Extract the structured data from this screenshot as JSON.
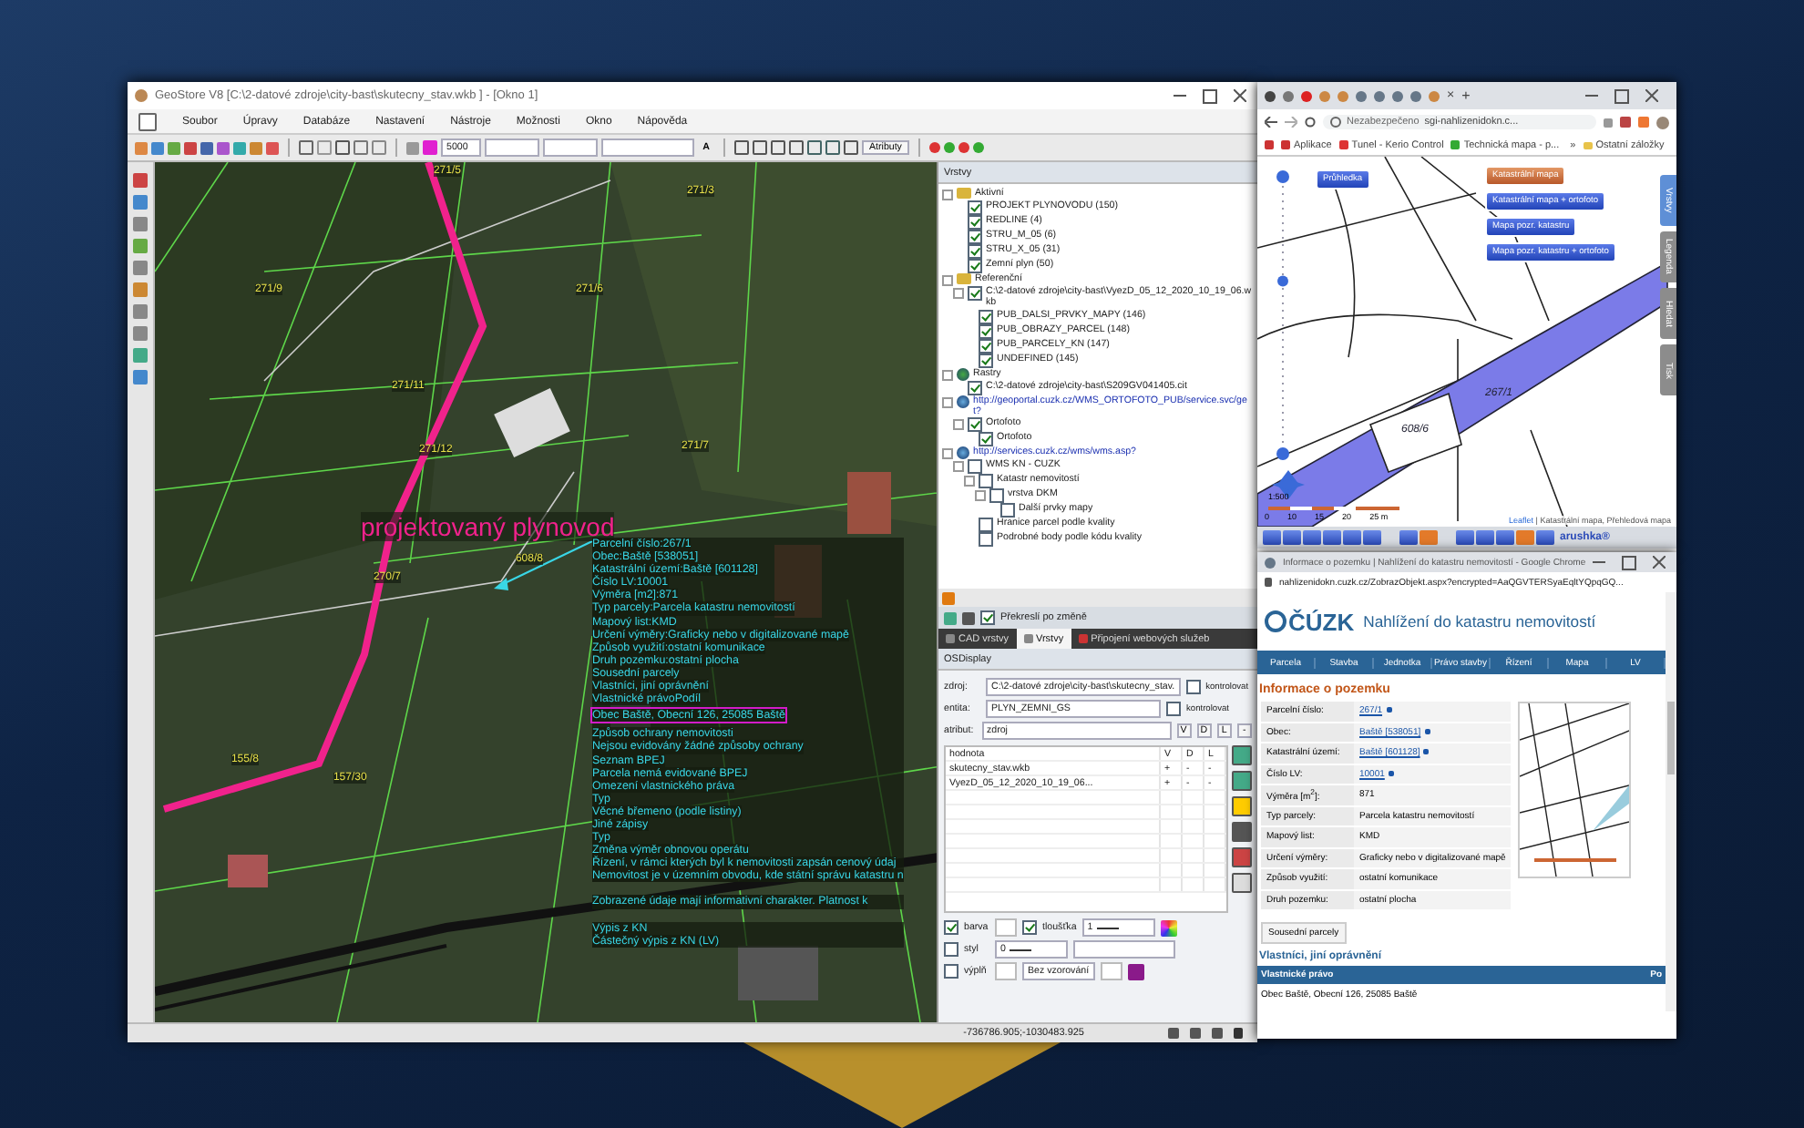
{
  "main_window": {
    "title": "GeoStore V8 [C:\\2-datové zdroje\\city-bast\\skutecny_stav.wkb ] - [Okno 1]",
    "menu": [
      "Soubor",
      "Úpravy",
      "Databáze",
      "Nastavení",
      "Nástroje",
      "Možnosti",
      "Okno",
      "Nápověda"
    ],
    "toolbar": {
      "scale": "5000",
      "text_button": "A",
      "attributes_button": "Atributy"
    },
    "map": {
      "route_label": "projektovaný plynovod",
      "parcel_labels": [
        "271/5",
        "271/3",
        "271/9",
        "271/6",
        "271/11",
        "271/12",
        "271/7",
        "270/7",
        "608/8",
        "155/8",
        "157/30"
      ],
      "info_blocks": [
        [
          {
            "text": "Parcelní číslo:267/1",
            "highlighted": false
          },
          {
            "text": "Obec:Baště [538051]",
            "highlighted": false
          },
          {
            "text": "Katastrální území:Baště [601128]",
            "highlighted": false
          },
          {
            "text": "Číslo LV:10001",
            "highlighted": false
          },
          {
            "text": "Výměra [m2]:871",
            "highlighted": false
          },
          {
            "text": "Typ parcely:Parcela katastru nemovitostí",
            "highlighted": false
          },
          {
            "text": "Mapový list:KMD",
            "highlighted": false
          },
          {
            "text": "Určení výměry:Graficky nebo v digitalizované mapě",
            "highlighted": false
          },
          {
            "text": "Způsob využití:ostatní komunikace",
            "highlighted": false
          },
          {
            "text": "Druh pozemku:ostatní plocha",
            "highlighted": false
          },
          {
            "text": "Sousední parcely",
            "highlighted": false
          },
          {
            "text": "Vlastníci, jiní oprávnění",
            "highlighted": false
          },
          {
            "text": "Vlastnické právoPodíl",
            "highlighted": false
          },
          {
            "text": "Obec Baště, Obecní 126, 25085 Baště",
            "highlighted": true
          },
          {
            "text": "Způsob ochrany nemovitosti",
            "highlighted": false
          },
          {
            "text": "Nejsou evidovány žádné způsoby ochrany",
            "highlighted": false
          },
          {
            "text": "Seznam BPEJ",
            "highlighted": false
          },
          {
            "text": "Parcela nemá evidované BPEJ",
            "highlighted": false
          },
          {
            "text": "Omezení vlastnického práva",
            "highlighted": false
          },
          {
            "text": "Typ",
            "highlighted": false
          },
          {
            "text": "Věcné břemeno (podle listiny)",
            "highlighted": false
          },
          {
            "text": "Jiné zápisy",
            "highlighted": false
          },
          {
            "text": "Typ",
            "highlighted": false
          },
          {
            "text": "Změna výměr obnovou operátu",
            "highlighted": false
          },
          {
            "text": "Řízení, v rámci kterých byl k nemovitosti zapsán cenový údaj",
            "highlighted": false
          },
          {
            "text": "Nemovitost je v územním obvodu, kde státní správu katastru n",
            "highlighted": false
          }
        ],
        [
          {
            "text": "Zobrazené údaje mají informativní charakter. Platnost k",
            "highlighted": false
          }
        ],
        [
          {
            "text": "Výpis z KN",
            "highlighted": false
          },
          {
            "text": "Částečný výpis z KN (LV)",
            "highlighted": false
          }
        ]
      ]
    },
    "layers_panel": {
      "title": "Vrstvy",
      "tree": [
        {
          "label": "Aktivní",
          "kind": "folder",
          "children": [
            {
              "label": "PROJEKT PLYNOVODU (150)",
              "kind": "layer",
              "checked": true
            },
            {
              "label": "REDLINE (4)",
              "kind": "layer",
              "checked": true
            },
            {
              "label": "STRU_M_05 (6)",
              "kind": "layer",
              "checked": true
            },
            {
              "label": "STRU_X_05 (31)",
              "kind": "layer",
              "checked": true
            },
            {
              "label": "Zemní plyn (50)",
              "kind": "layer",
              "checked": true
            }
          ]
        },
        {
          "label": "Referenční",
          "kind": "folder",
          "children": [
            {
              "label": "C:\\2-datové zdroje\\city-bast\\VyezD_05_12_2020_10_19_06.wkb",
              "kind": "layer",
              "checked": true,
              "children": [
                {
                  "label": "PUB_DALSI_PRVKY_MAPY (146)",
                  "kind": "layer",
                  "checked": true
                },
                {
                  "label": "PUB_OBRAZY_PARCEL (148)",
                  "kind": "layer",
                  "checked": true
                },
                {
                  "label": "PUB_PARCELY_KN (147)",
                  "kind": "layer",
                  "checked": true
                },
                {
                  "label": "UNDEFINED (145)",
                  "kind": "layer",
                  "checked": true
                }
              ]
            }
          ]
        },
        {
          "label": "Rastry",
          "kind": "raster",
          "children": [
            {
              "label": "C:\\2-datové zdroje\\city-bast\\S209GV041405.cit",
              "kind": "layer",
              "checked": true
            }
          ]
        },
        {
          "label": "http://geoportal.cuzk.cz/WMS_ORTOFOTO_PUB/service.svc/get?",
          "kind": "globe",
          "children": [
            {
              "label": "Ortofoto",
              "kind": "layer",
              "checked": true,
              "children": [
                {
                  "label": "Ortofoto",
                  "kind": "layer",
                  "checked": true
                }
              ]
            }
          ]
        },
        {
          "label": "http://services.cuzk.cz/wms/wms.asp?",
          "kind": "globe",
          "children": [
            {
              "label": "WMS KN - CUZK",
              "kind": "layer",
              "checked": false,
              "children": [
                {
                  "label": "Katastr nemovitostí",
                  "kind": "layer",
                  "checked": false,
                  "children": [
                    {
                      "label": "vrstva DKM",
                      "kind": "layer",
                      "checked": false,
                      "children": [
                        {
                          "label": "Další prvky mapy",
                          "kind": "layer",
                          "checked": false
                        }
                      ]
                    }
                  ]
                },
                {
                  "label": "Hranice parcel podle kvality",
                  "kind": "layer",
                  "checked": false
                },
                {
                  "label": "Podrobné body podle kódu kvality",
                  "kind": "layer",
                  "checked": false
                }
              ]
            }
          ]
        }
      ]
    },
    "redraw_option": {
      "label": "Překreslí po změně",
      "checked": true
    },
    "tabs": [
      {
        "label": "CAD vrstvy",
        "selected": false
      },
      {
        "label": "Vrstvy",
        "selected": true
      },
      {
        "label": "Připojení webových služeb",
        "selected": false
      }
    ],
    "display_panel": {
      "title": "OSDisplay",
      "fields": [
        {
          "label": "zdroj:",
          "value": "C:\\2-datové zdroje\\city-bast\\skutecny_stav.",
          "check_label": "kontrolovat",
          "checked": false
        },
        {
          "label": "entita:",
          "value": "PLYN_ZEMNI_GS",
          "check_label": "kontrolovat",
          "checked": false
        },
        {
          "label": "atribut:",
          "value": "zdroj",
          "buttons": [
            "V",
            "D",
            "L",
            "-"
          ]
        }
      ],
      "table": {
        "columns": [
          "hodnota",
          "V",
          "D",
          "L"
        ],
        "rows": [
          [
            "skutecny_stav.wkb",
            "+",
            "-",
            "-"
          ],
          [
            "VyezD_05_12_2020_10_19_06...",
            "+",
            "-",
            "-"
          ]
        ]
      },
      "style_rows": [
        [
          {
            "kind": "check",
            "label": "barva",
            "checked": true
          },
          {
            "kind": "swatch"
          },
          {
            "kind": "check",
            "label": "tloušťka",
            "checked": true
          },
          {
            "kind": "select",
            "value": "1"
          }
        ],
        [
          {
            "kind": "check",
            "label": "styl",
            "checked": false
          },
          {
            "kind": "select",
            "value": "0"
          },
          {
            "kind": "input"
          }
        ],
        [
          {
            "kind": "check",
            "label": "výplň",
            "checked": false
          },
          {
            "kind": "swatch"
          },
          {
            "kind": "select",
            "value": "Bez vzorování"
          },
          {
            "kind": "swatch"
          }
        ]
      ]
    },
    "status_bar": {
      "coordinates": "-736786.905;-1030483.925"
    }
  },
  "browser_map": {
    "tab_close": "×",
    "new_tab": "+",
    "security": "Nezabezpečeno",
    "url": "sgi-nahlizenidokn.c...",
    "bookmarks": [
      "Aplikace",
      "Tunel - Kerio Control",
      "Technická mapa - p..."
    ],
    "more": "»",
    "other_bookmarks": "Ostatní záložky",
    "transparency_button": "Průhledka",
    "zoom_slider": {
      "level": 0.63
    },
    "layer_buttons": [
      {
        "label": "Katastrální mapa",
        "selected": true
      },
      {
        "label": "Katastrální mapa + ortofoto",
        "selected": false
      },
      {
        "label": "Mapa pozr. katastru",
        "selected": false
      },
      {
        "label": "Mapa pozr. katastru + ortofoto",
        "selected": false
      }
    ],
    "side_tabs": [
      {
        "label": "Vrstvy",
        "selected": true
      },
      {
        "label": "Legenda",
        "selected": false
      },
      {
        "label": "Hledat",
        "selected": false
      },
      {
        "label": "Tisk",
        "selected": false
      }
    ],
    "parcel_labels": [
      "608/6",
      "267/1"
    ],
    "scale_ratio": "1:500",
    "scale_ticks": [
      "0",
      "10",
      "15",
      "20",
      "25 m"
    ],
    "attribution_link": "Leaflet",
    "attribution": "| Katastrální mapa, Přehledová mapa",
    "logo": "arushka®"
  },
  "browser_info": {
    "title": "Informace o pozemku | Nahlížení do katastru nemovitostí - Google Chrome",
    "url": "nahlizenidokn.cuzk.cz/ZobrazObjekt.aspx?encrypted=AaQGVTERSyaEqltYQpqGQ...",
    "logo": "ČÚZK",
    "site_title": "Nahlížení do katastru nemovitostí",
    "nav": [
      "Parcela",
      "Stavba",
      "Jednotka",
      "Právo stavby",
      "Řízení",
      "Mapa",
      "LV"
    ],
    "heading": "Informace o pozemku",
    "rows": [
      {
        "label": "Parcelní číslo:",
        "value": "267/1",
        "link": true
      },
      {
        "label": "Obec:",
        "value": "Baště [538051]",
        "link": true
      },
      {
        "label": "Katastrální území:",
        "value": "Baště [601128]",
        "link": true
      },
      {
        "label": "Číslo LV:",
        "value": "10001",
        "link": true
      },
      {
        "label": "Výměra [m$^{2}$]:",
        "value": "871",
        "link": false
      },
      {
        "label": "Typ parcely:",
        "value": "Parcela katastru nemovitostí",
        "link": false
      },
      {
        "label": "Mapový list:",
        "value": "KMD",
        "link": false
      },
      {
        "label": "Určení výměry:",
        "value": "Graficky nebo v digitalizované mapě",
        "link": false
      },
      {
        "label": "Způsob využití:",
        "value": "ostatní komunikace",
        "link": false
      },
      {
        "label": "Druh pozemku:",
        "value": "ostatní plocha",
        "link": false
      }
    ],
    "neighbors_button": "Sousední parcely",
    "owners_heading": "Vlastníci, jiní oprávnění",
    "owners_header": "Vlastnické právo",
    "owners_header_2": "Po",
    "owners_row": "Obec Baště, Obecní 126, 25085 Baště"
  }
}
